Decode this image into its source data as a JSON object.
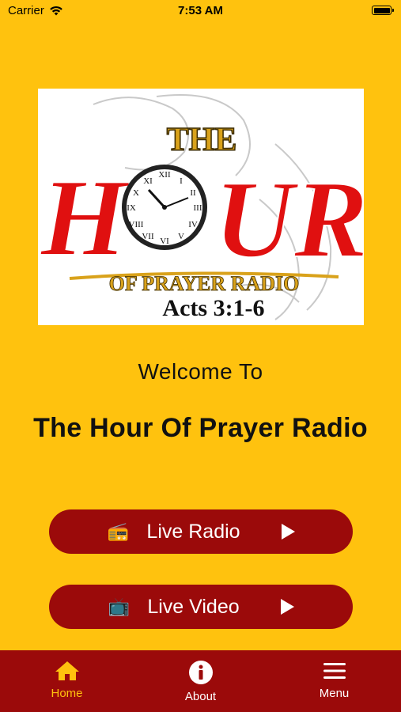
{
  "status_bar": {
    "carrier": "Carrier",
    "time": "7:53 AM"
  },
  "logo": {
    "line_the": "THE",
    "line_hour_left": "H",
    "line_hour_right": "UR",
    "line_radio": "OF PRAYER RADIO",
    "verse": "Acts 3:1-6"
  },
  "welcome": {
    "greeting": "Welcome To",
    "station_name": "The Hour Of Prayer Radio"
  },
  "buttons": {
    "live_radio": {
      "label": "Live Radio",
      "icon": "radio-icon",
      "emoji": "📻"
    },
    "live_video": {
      "label": "Live Video",
      "icon": "tv-icon",
      "emoji": "📺"
    }
  },
  "tabs": [
    {
      "label": "Home",
      "icon": "home-icon",
      "active": true
    },
    {
      "label": "About",
      "icon": "info-icon",
      "active": false
    },
    {
      "label": "Menu",
      "icon": "menu-icon",
      "active": false
    }
  ],
  "colors": {
    "background": "#FFC20E",
    "brand_red": "#9B0A0A",
    "active_tab": "#FFC20E"
  }
}
